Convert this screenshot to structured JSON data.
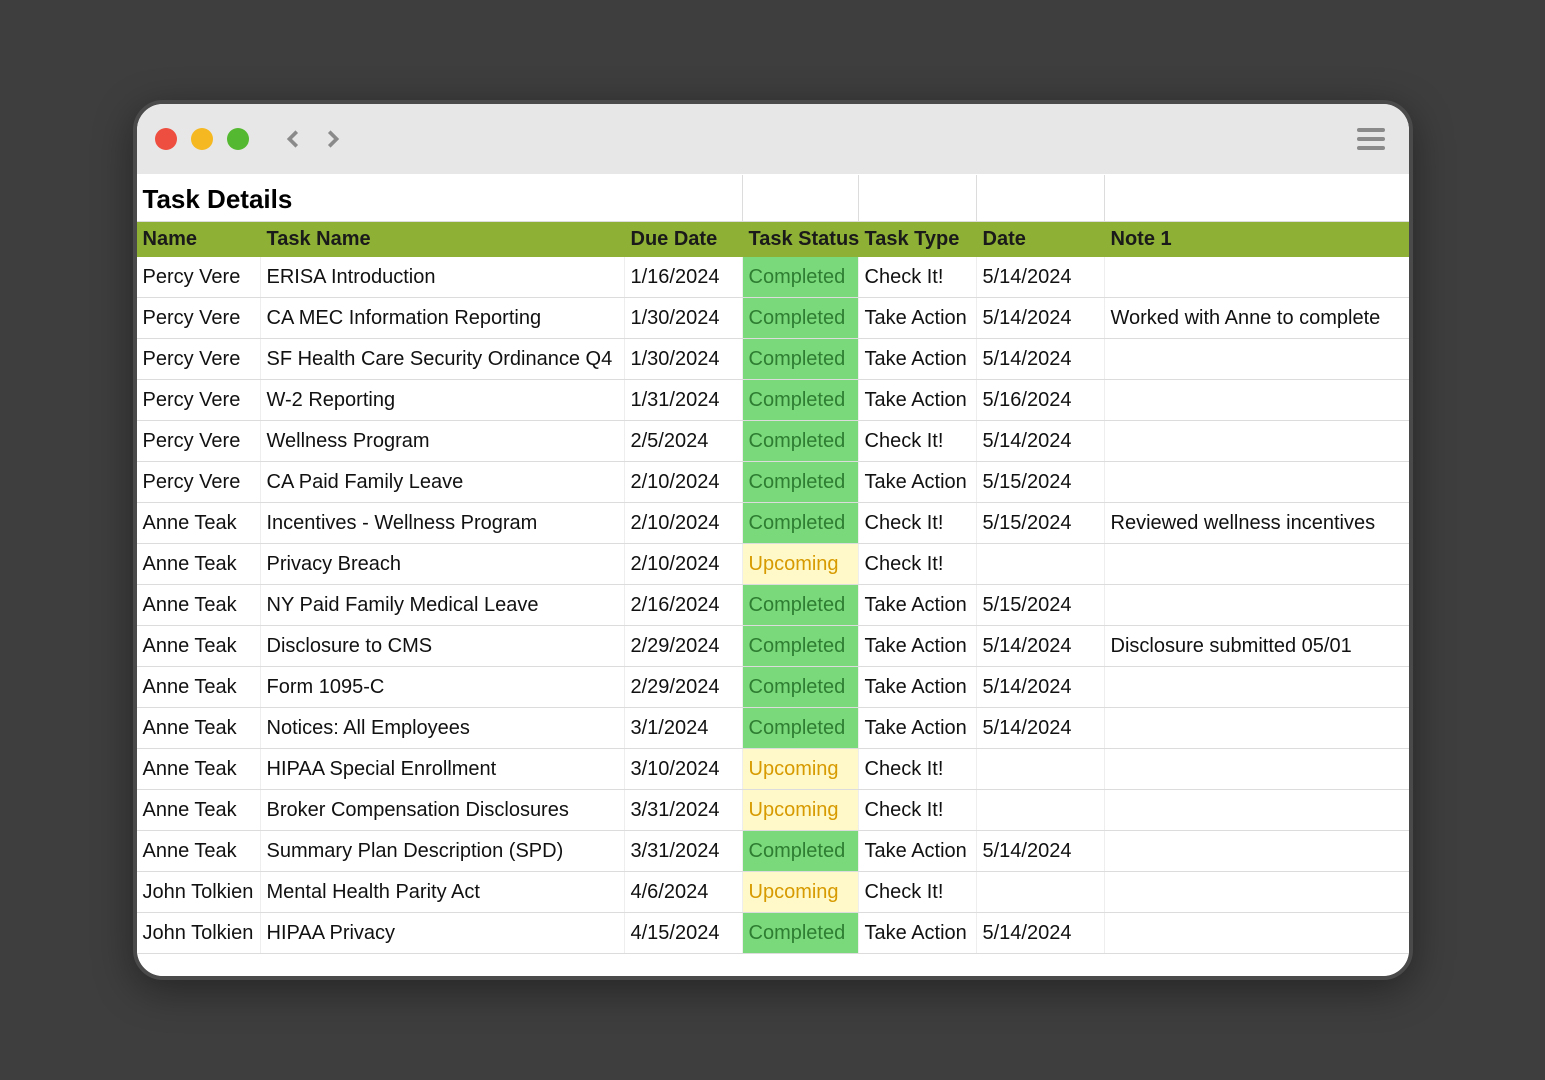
{
  "page_title": "Task Details",
  "columns": [
    "Name",
    "Task Name",
    "Due Date",
    "Task Status",
    "Task Type",
    "Date",
    "Note 1"
  ],
  "status_styles": {
    "Completed": "status-completed",
    "Upcoming": "status-upcoming"
  },
  "rows": [
    {
      "name": "Percy Vere",
      "task": "ERISA Introduction",
      "due": "1/16/2024",
      "status": "Completed",
      "type": "Check It!",
      "date": "5/14/2024",
      "note": ""
    },
    {
      "name": "Percy Vere",
      "task": "CA MEC Information Reporting",
      "due": "1/30/2024",
      "status": "Completed",
      "type": "Take Action",
      "date": "5/14/2024",
      "note": "Worked with Anne to complete"
    },
    {
      "name": "Percy Vere",
      "task": "SF Health Care Security Ordinance Q4",
      "due": "1/30/2024",
      "status": "Completed",
      "type": "Take Action",
      "date": "5/14/2024",
      "note": ""
    },
    {
      "name": "Percy Vere",
      "task": "W-2 Reporting",
      "due": "1/31/2024",
      "status": "Completed",
      "type": "Take Action",
      "date": "5/16/2024",
      "note": ""
    },
    {
      "name": "Percy Vere",
      "task": "Wellness Program",
      "due": "2/5/2024",
      "status": "Completed",
      "type": "Check It!",
      "date": "5/14/2024",
      "note": ""
    },
    {
      "name": "Percy Vere",
      "task": "CA Paid Family Leave",
      "due": "2/10/2024",
      "status": "Completed",
      "type": "Take Action",
      "date": "5/15/2024",
      "note": ""
    },
    {
      "name": "Anne Teak",
      "task": "Incentives - Wellness Program",
      "due": "2/10/2024",
      "status": "Completed",
      "type": "Check It!",
      "date": "5/15/2024",
      "note": "Reviewed wellness incentives"
    },
    {
      "name": "Anne Teak",
      "task": "Privacy Breach",
      "due": "2/10/2024",
      "status": "Upcoming",
      "type": "Check It!",
      "date": "",
      "note": ""
    },
    {
      "name": "Anne Teak",
      "task": "NY Paid Family Medical Leave",
      "due": "2/16/2024",
      "status": "Completed",
      "type": "Take Action",
      "date": "5/15/2024",
      "note": ""
    },
    {
      "name": "Anne Teak",
      "task": "Disclosure to CMS",
      "due": "2/29/2024",
      "status": "Completed",
      "type": "Take Action",
      "date": "5/14/2024",
      "note": "Disclosure submitted 05/01"
    },
    {
      "name": "Anne Teak",
      "task": "Form 1095-C",
      "due": "2/29/2024",
      "status": "Completed",
      "type": "Take Action",
      "date": "5/14/2024",
      "note": ""
    },
    {
      "name": "Anne Teak",
      "task": "Notices: All Employees",
      "due": "3/1/2024",
      "status": "Completed",
      "type": "Take Action",
      "date": "5/14/2024",
      "note": ""
    },
    {
      "name": "Anne Teak",
      "task": "HIPAA Special Enrollment",
      "due": "3/10/2024",
      "status": "Upcoming",
      "type": "Check It!",
      "date": "",
      "note": ""
    },
    {
      "name": "Anne Teak",
      "task": "Broker Compensation Disclosures",
      "due": "3/31/2024",
      "status": "Upcoming",
      "type": "Check It!",
      "date": "",
      "note": ""
    },
    {
      "name": "Anne Teak",
      "task": "Summary Plan Description (SPD)",
      "due": "3/31/2024",
      "status": "Completed",
      "type": "Take Action",
      "date": "5/14/2024",
      "note": ""
    },
    {
      "name": "John Tolkien",
      "task": "Mental Health Parity Act",
      "due": "4/6/2024",
      "status": "Upcoming",
      "type": "Check It!",
      "date": "",
      "note": ""
    },
    {
      "name": "John Tolkien",
      "task": "HIPAA Privacy",
      "due": "4/15/2024",
      "status": "Completed",
      "type": "Take Action",
      "date": "5/14/2024",
      "note": ""
    }
  ]
}
